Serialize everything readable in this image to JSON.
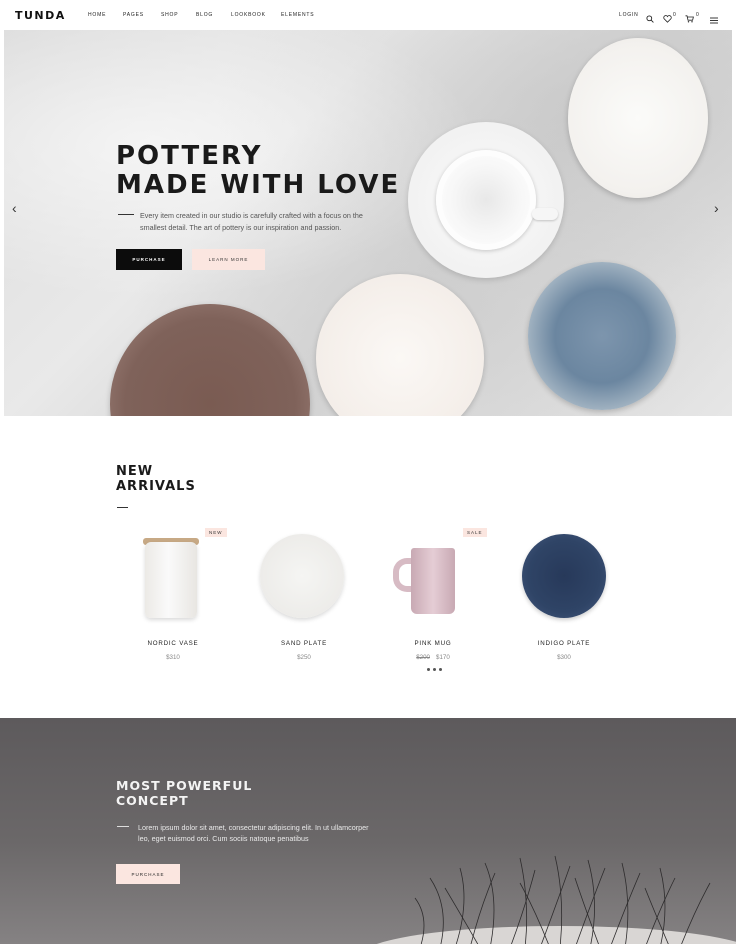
{
  "brand": {
    "logo": "TUNDA"
  },
  "nav": {
    "items": [
      "HOME",
      "PAGES",
      "SHOP",
      "BLOG",
      "LOOKBOOK",
      "ELEMENTS"
    ],
    "login": "LOGIN",
    "wishlist_count": "0",
    "cart_count": "0"
  },
  "hero": {
    "title_line1": "POTTERY",
    "title_line2": "MADE WITH LOVE",
    "description": "Every item created in our studio is carefully crafted with a focus on the smallest detail. The art of pottery is our inspiration and passion.",
    "primary_button": "PURCHASE",
    "secondary_button": "LEARN MORE",
    "prev_arrow": "‹",
    "next_arrow": "›"
  },
  "arrivals": {
    "title_line1": "NEW",
    "title_line2": "ARRIVALS",
    "products": [
      {
        "name": "NORDIC VASE",
        "price": "$310",
        "old_price": "",
        "badge": "NEW"
      },
      {
        "name": "SAND PLATE",
        "price": "$250",
        "old_price": "",
        "badge": ""
      },
      {
        "name": "PINK MUG",
        "price": "$170",
        "old_price": "$200",
        "badge": "SALE"
      },
      {
        "name": "INDIGO PLATE",
        "price": "$300",
        "old_price": "",
        "badge": ""
      }
    ]
  },
  "concept": {
    "title_line1": "MOST POWERFUL",
    "title_line2": "CONCEPT",
    "description": "Lorem ipsum dolor sit amet, consectetur adipiscing elit. In ut ullamcorper leo, eget euismod orci. Cum sociis natoque penatibus",
    "button": "PURCHASE"
  },
  "icons": {
    "search": "search-icon",
    "wishlist": "heart-icon",
    "cart": "cart-icon",
    "menu": "hamburger-menu-icon"
  },
  "colors": {
    "accent_pink": "#fbe6e0",
    "dark_button": "#0c0c0c",
    "concept_bg": "#635f61"
  }
}
